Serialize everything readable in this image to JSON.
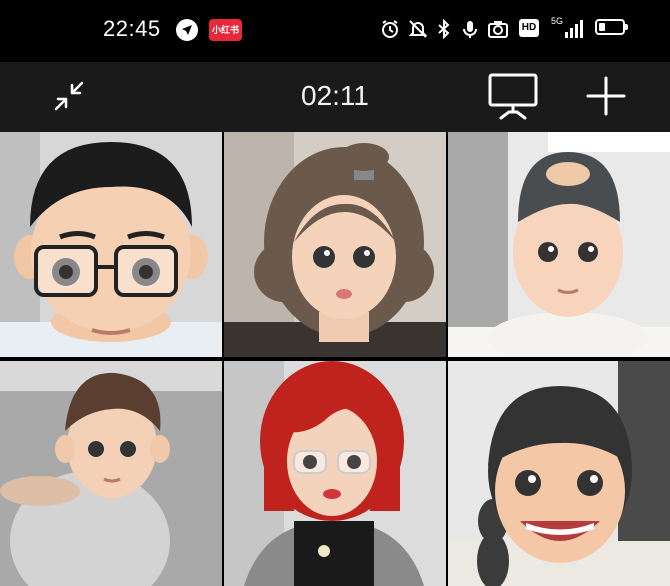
{
  "status_bar": {
    "time": "22:45",
    "app_badge": "小红书",
    "icons": [
      "navigation-icon",
      "alarm-icon",
      "mute-icon",
      "bluetooth-icon",
      "mic-icon",
      "camera-icon",
      "hd-icon",
      "signal-icon",
      "battery-icon"
    ],
    "hd_label": "HD",
    "network_label": "5G"
  },
  "toolbar": {
    "timer": "02:11",
    "minimize_icon": "collapse-arrows-icon",
    "screen_share_icon": "presentation-screen-icon",
    "add_icon": "plus-icon"
  },
  "participants": [
    {
      "avatar": "boy-with-glasses",
      "bg": "#dcdcdc"
    },
    {
      "avatar": "girl-wavy-hair",
      "bg": "#c8c0b6"
    },
    {
      "avatar": "boy-backwards-cap",
      "bg": "#e6e6e6"
    },
    {
      "avatar": "boy-with-cat",
      "bg": "#b9b9b9"
    },
    {
      "avatar": "girl-red-hair",
      "bg": "#d8d8d8"
    },
    {
      "avatar": "girl-braid-smiling",
      "bg": "#e4e4e4"
    }
  ],
  "colors": {
    "statusbar_bg": "#000000",
    "toolbar_bg": "#1a1a1a",
    "badge_red": "#e8283a"
  }
}
